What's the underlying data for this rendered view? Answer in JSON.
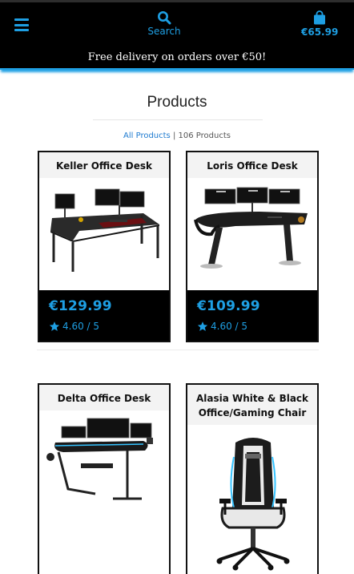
{
  "header": {
    "search_label": "Search",
    "cart_amount": "€65.99",
    "accent": "#1e9fe3"
  },
  "promo": {
    "text": "Free delivery on orders over €50!"
  },
  "page": {
    "title": "Products",
    "breadcrumb_link": "All Products",
    "breadcrumb_sep": " | ",
    "product_count": "106 Products"
  },
  "products": [
    {
      "name": "Keller Office Desk",
      "price": "€129.99",
      "rating": "4.60 / 5",
      "image": "l-shaped-desk-image"
    },
    {
      "name": "Loris Office Desk",
      "price": "€109.99",
      "rating": "4.60 / 5",
      "image": "desk-image"
    },
    {
      "name": "Delta Office Desk",
      "image": "gaming-desk-image"
    },
    {
      "name": "Alasia White & Black Office/Gaming Chair",
      "image": "gaming-chair-image"
    }
  ]
}
